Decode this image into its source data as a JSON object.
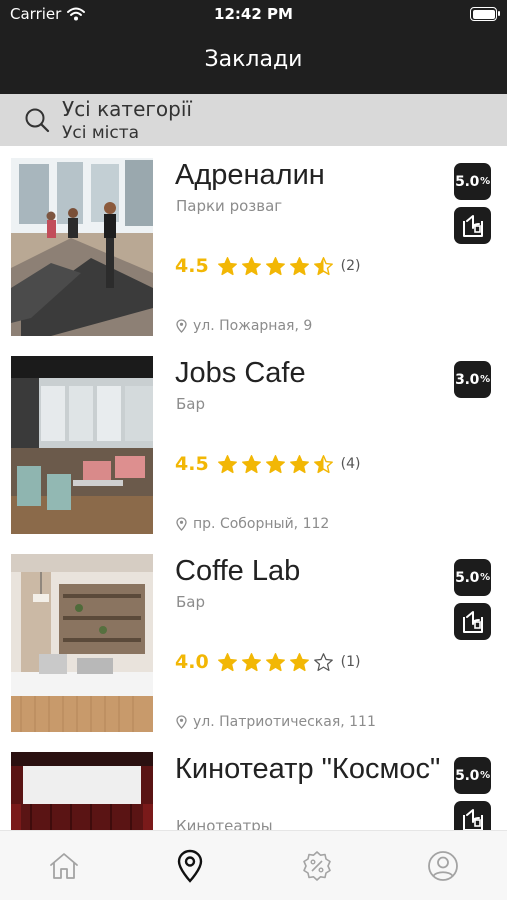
{
  "status_bar": {
    "carrier": "Carrier",
    "time": "12:42 PM"
  },
  "header": {
    "title": "Заклади"
  },
  "search": {
    "category": "Усі категорії",
    "city": "Усі міста"
  },
  "colors": {
    "accent": "#f2b705",
    "dark": "#1f1f1f",
    "search_bg": "#d9d9d9"
  },
  "places": [
    {
      "title": "Адреналин",
      "category": "Парки розваг",
      "rating": "4.5",
      "stars": 4.5,
      "reviews": "(2)",
      "address": "ул. Пожарная, 9",
      "discount": "5.0",
      "discount_unit": "%",
      "thumb": "gym"
    },
    {
      "title": "Jobs Cafe",
      "category": "Бар",
      "rating": "4.5",
      "stars": 4.5,
      "reviews": "(4)",
      "address": "пр. Соборный, 112",
      "discount": "3.0",
      "discount_unit": "%",
      "thumb": "cafe"
    },
    {
      "title": "Coffe Lab",
      "category": "Бар",
      "rating": "4.0",
      "stars": 4.0,
      "reviews": "(1)",
      "address": "ул. Патриотическая, 111",
      "discount": "5.0",
      "discount_unit": "%",
      "thumb": "coffee"
    },
    {
      "title": "Кинотеатр \"Космос\"",
      "category": "Кинотеатры",
      "discount": "5.0",
      "discount_unit": "%",
      "thumb": "cinema"
    }
  ],
  "tabs": [
    {
      "icon": "home-icon"
    },
    {
      "icon": "map-pin-icon",
      "active": true
    },
    {
      "icon": "discount-icon"
    },
    {
      "icon": "profile-icon"
    }
  ]
}
